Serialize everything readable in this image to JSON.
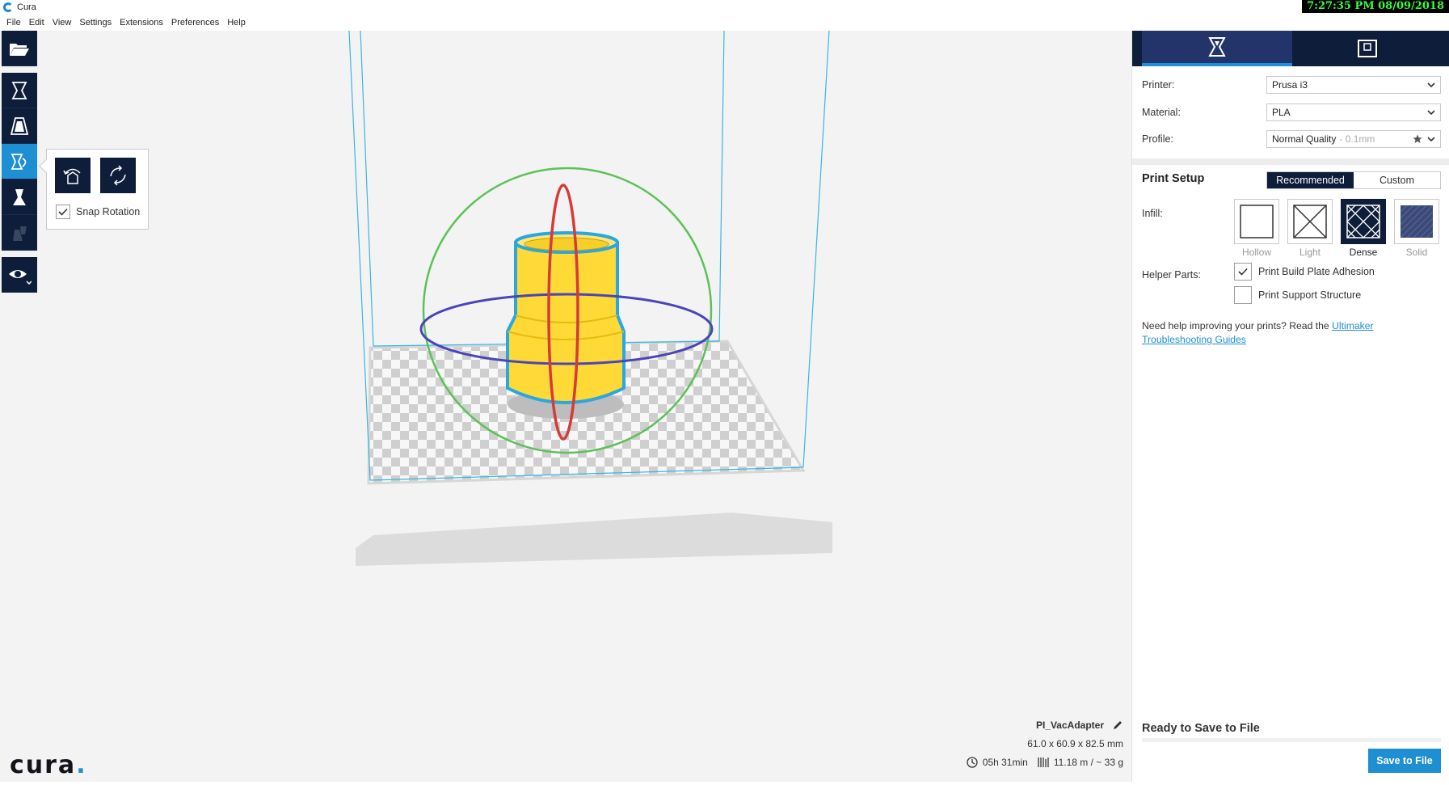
{
  "window": {
    "title": "Cura",
    "clock": "7:27:35 PM 08/09/2018"
  },
  "menu": [
    "File",
    "Edit",
    "View",
    "Settings",
    "Extensions",
    "Preferences",
    "Help"
  ],
  "toolbar": {
    "icons": [
      "open-folder-icon",
      "move-tool-icon",
      "scale-tool-icon",
      "rotate-tool-icon",
      "mirror-tool-icon",
      "per-model-settings-icon",
      "view-mode-icon"
    ],
    "active_tool": "rotate"
  },
  "rotate_panel": {
    "snap_label": "Snap Rotation",
    "snap_checked": true
  },
  "logo": {
    "text": "cura",
    "dot": "."
  },
  "object": {
    "name": "PI_VacAdapter",
    "dimensions": "61.0 x 60.9 x 82.5 mm",
    "print_time": "05h 31min",
    "material_usage": "11.18 m / ~ 33 g"
  },
  "sidebar": {
    "printer_label": "Printer:",
    "printer_value": "Prusa i3",
    "material_label": "Material:",
    "material_value": "PLA",
    "profile_label": "Profile:",
    "profile_value": "Normal Quality",
    "profile_detail": "- 0.1mm",
    "print_setup_title": "Print Setup",
    "mode_recommended": "Recommended",
    "mode_custom": "Custom",
    "infill_label": "Infill:",
    "infill_options": [
      "Hollow",
      "Light",
      "Dense",
      "Solid"
    ],
    "infill_selected": "Dense",
    "helper_label": "Helper Parts:",
    "adhesion_label": "Print Build Plate Adhesion",
    "adhesion_checked": true,
    "support_label": "Print Support Structure",
    "support_checked": false,
    "help_prefix": "Need help improving your prints? Read the ",
    "help_link": "Ultimaker Troubleshooting Guides",
    "ready_title": "Ready to Save to File",
    "save_button": "Save to File"
  },
  "colors": {
    "accent": "#1e8fd2",
    "toolbar_dark": "#0e1d3a",
    "model_yellow": "#ffe25c",
    "ring_red": "#d63a3a",
    "ring_blue": "#4a46b8",
    "ring_green": "#5dc05a"
  }
}
